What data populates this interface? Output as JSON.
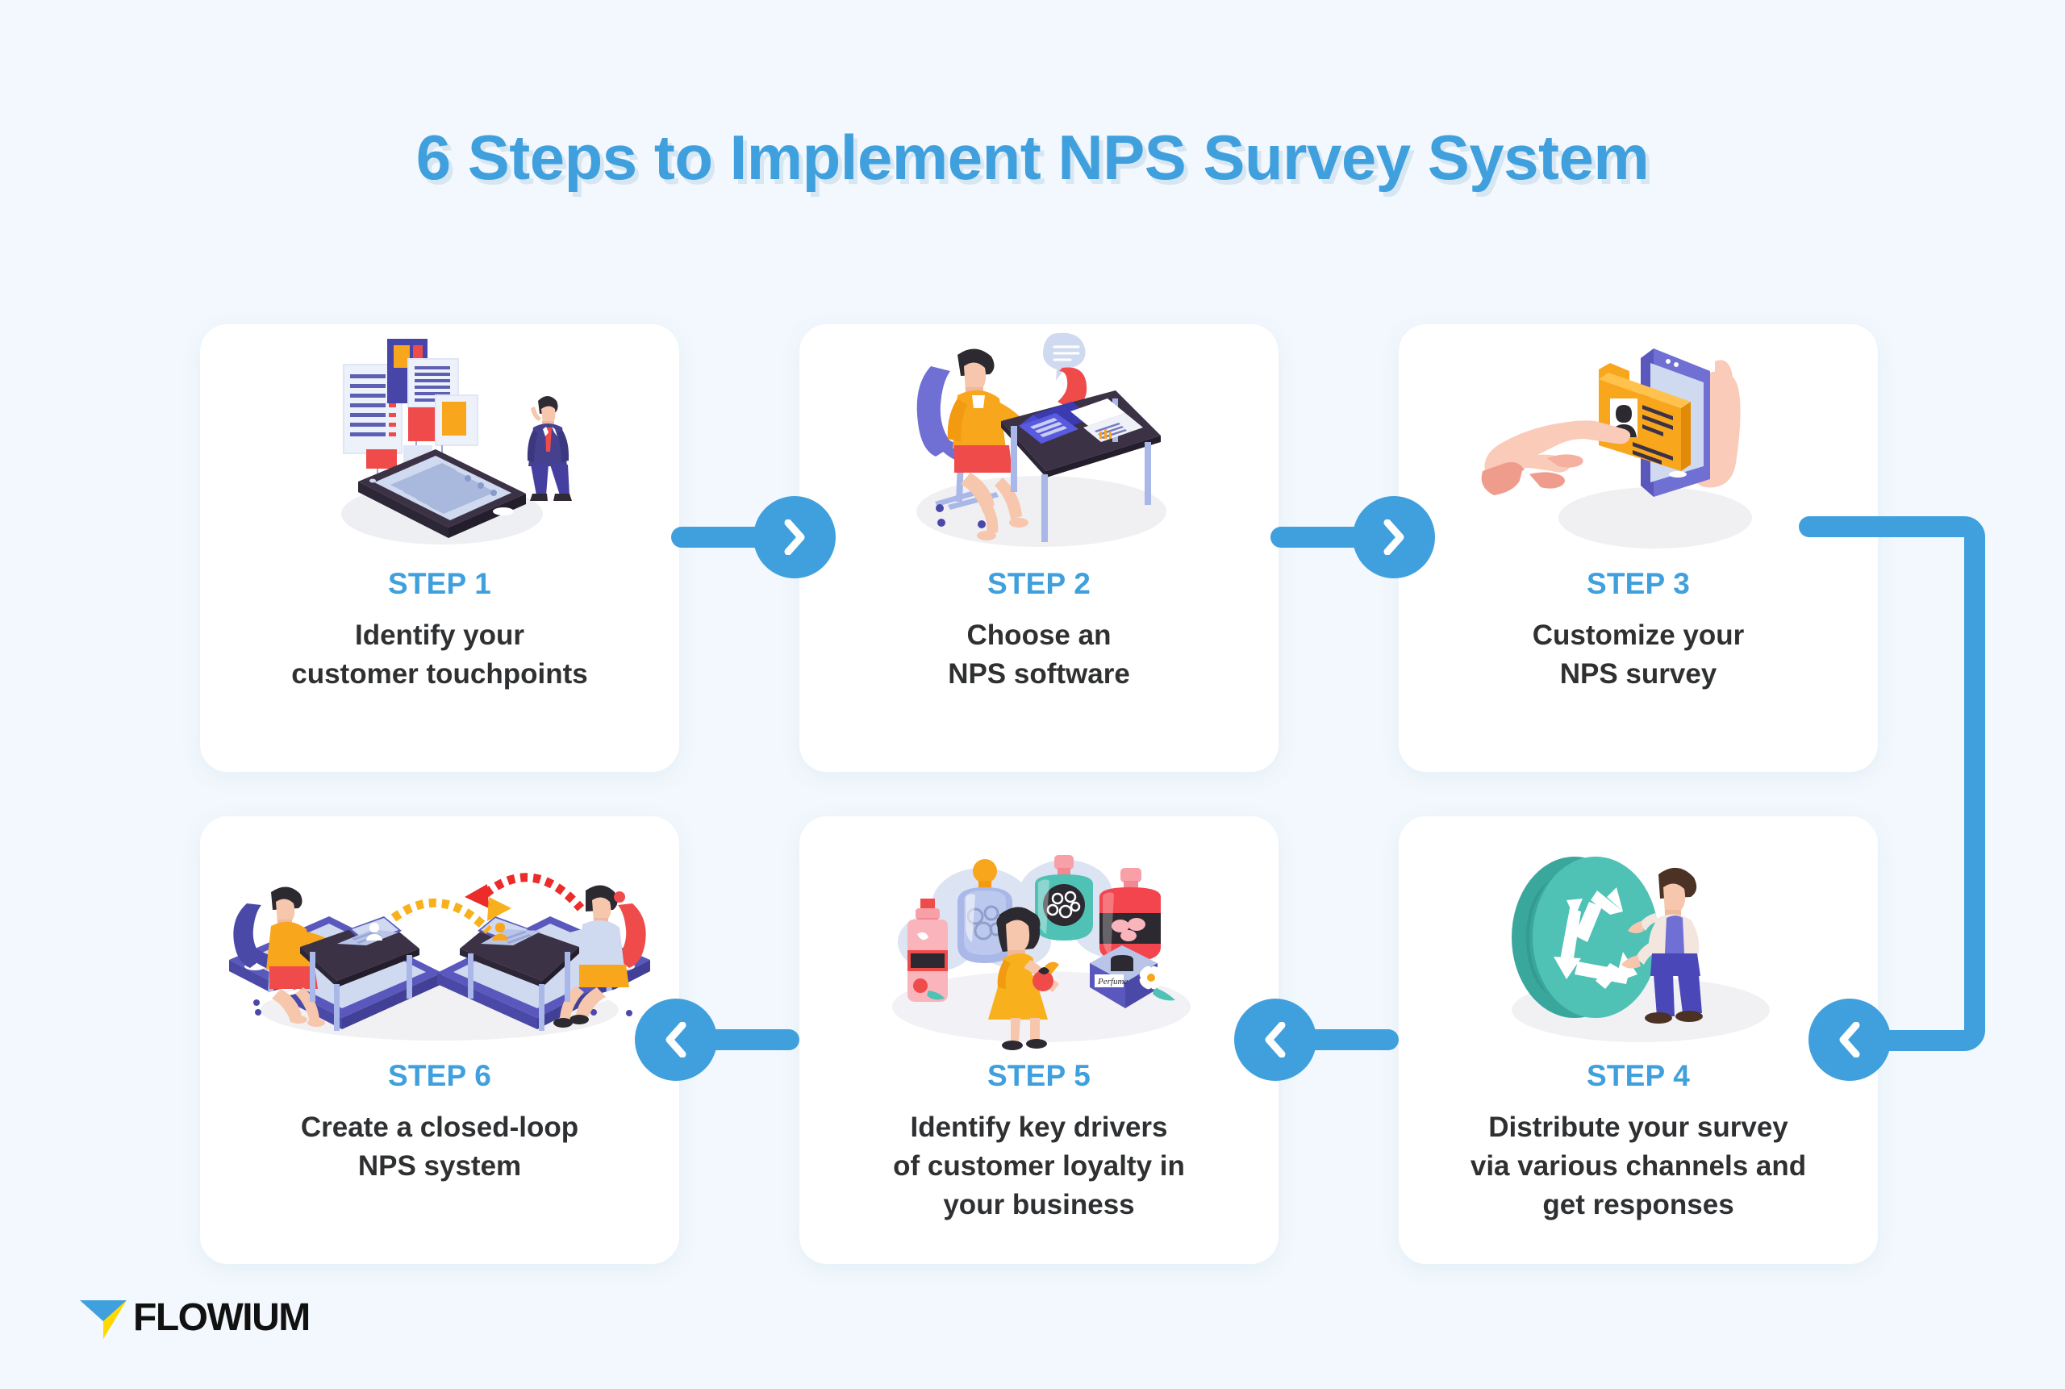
{
  "page": {
    "title": "6 Steps to Implement NPS Survey System",
    "background_color": "#f2f8fd",
    "accent_color": "#3fa0dd",
    "card_color": "#ffffff",
    "text_color": "#2f3032"
  },
  "steps": [
    {
      "label": "STEP 1",
      "description": "Identify your\ncustomer touchpoints",
      "illustration": "smartphone-with-floating-content-cards-and-businessman"
    },
    {
      "label": "STEP 2",
      "description": "Choose an\nNPS software",
      "illustration": "person-at-desk-with-laptop-and-speech-bubble"
    },
    {
      "label": "STEP 3",
      "description": "Customize your\nNPS survey",
      "illustration": "hands-holding-phone-tapping-profile-card"
    },
    {
      "label": "STEP 4",
      "description": "Distribute your survey\nvia various channels and\nget responses",
      "illustration": "person-with-teal-recycle-arrows-disc"
    },
    {
      "label": "STEP 5",
      "description": "Identify key drivers\nof customer loyalty in\nyour business",
      "illustration": "woman-choosing-among-perfume-bottles"
    },
    {
      "label": "STEP 6",
      "description": "Create a closed-loop\nNPS system",
      "illustration": "two-people-on-phones-exchanging-feedback-arrows"
    }
  ],
  "connectors": [
    {
      "name": "arrow-step1-to-step2",
      "direction": "right"
    },
    {
      "name": "arrow-step2-to-step3",
      "direction": "right"
    },
    {
      "name": "arrow-step3-to-step4",
      "direction": "left"
    },
    {
      "name": "arrow-step4-to-step5",
      "direction": "left"
    },
    {
      "name": "arrow-step5-to-step6",
      "direction": "left"
    }
  ],
  "branding": {
    "logo_text": "FLOWIUM",
    "logo_mark_blue": "#3fa0dd",
    "logo_mark_yellow": "#ffd900"
  }
}
